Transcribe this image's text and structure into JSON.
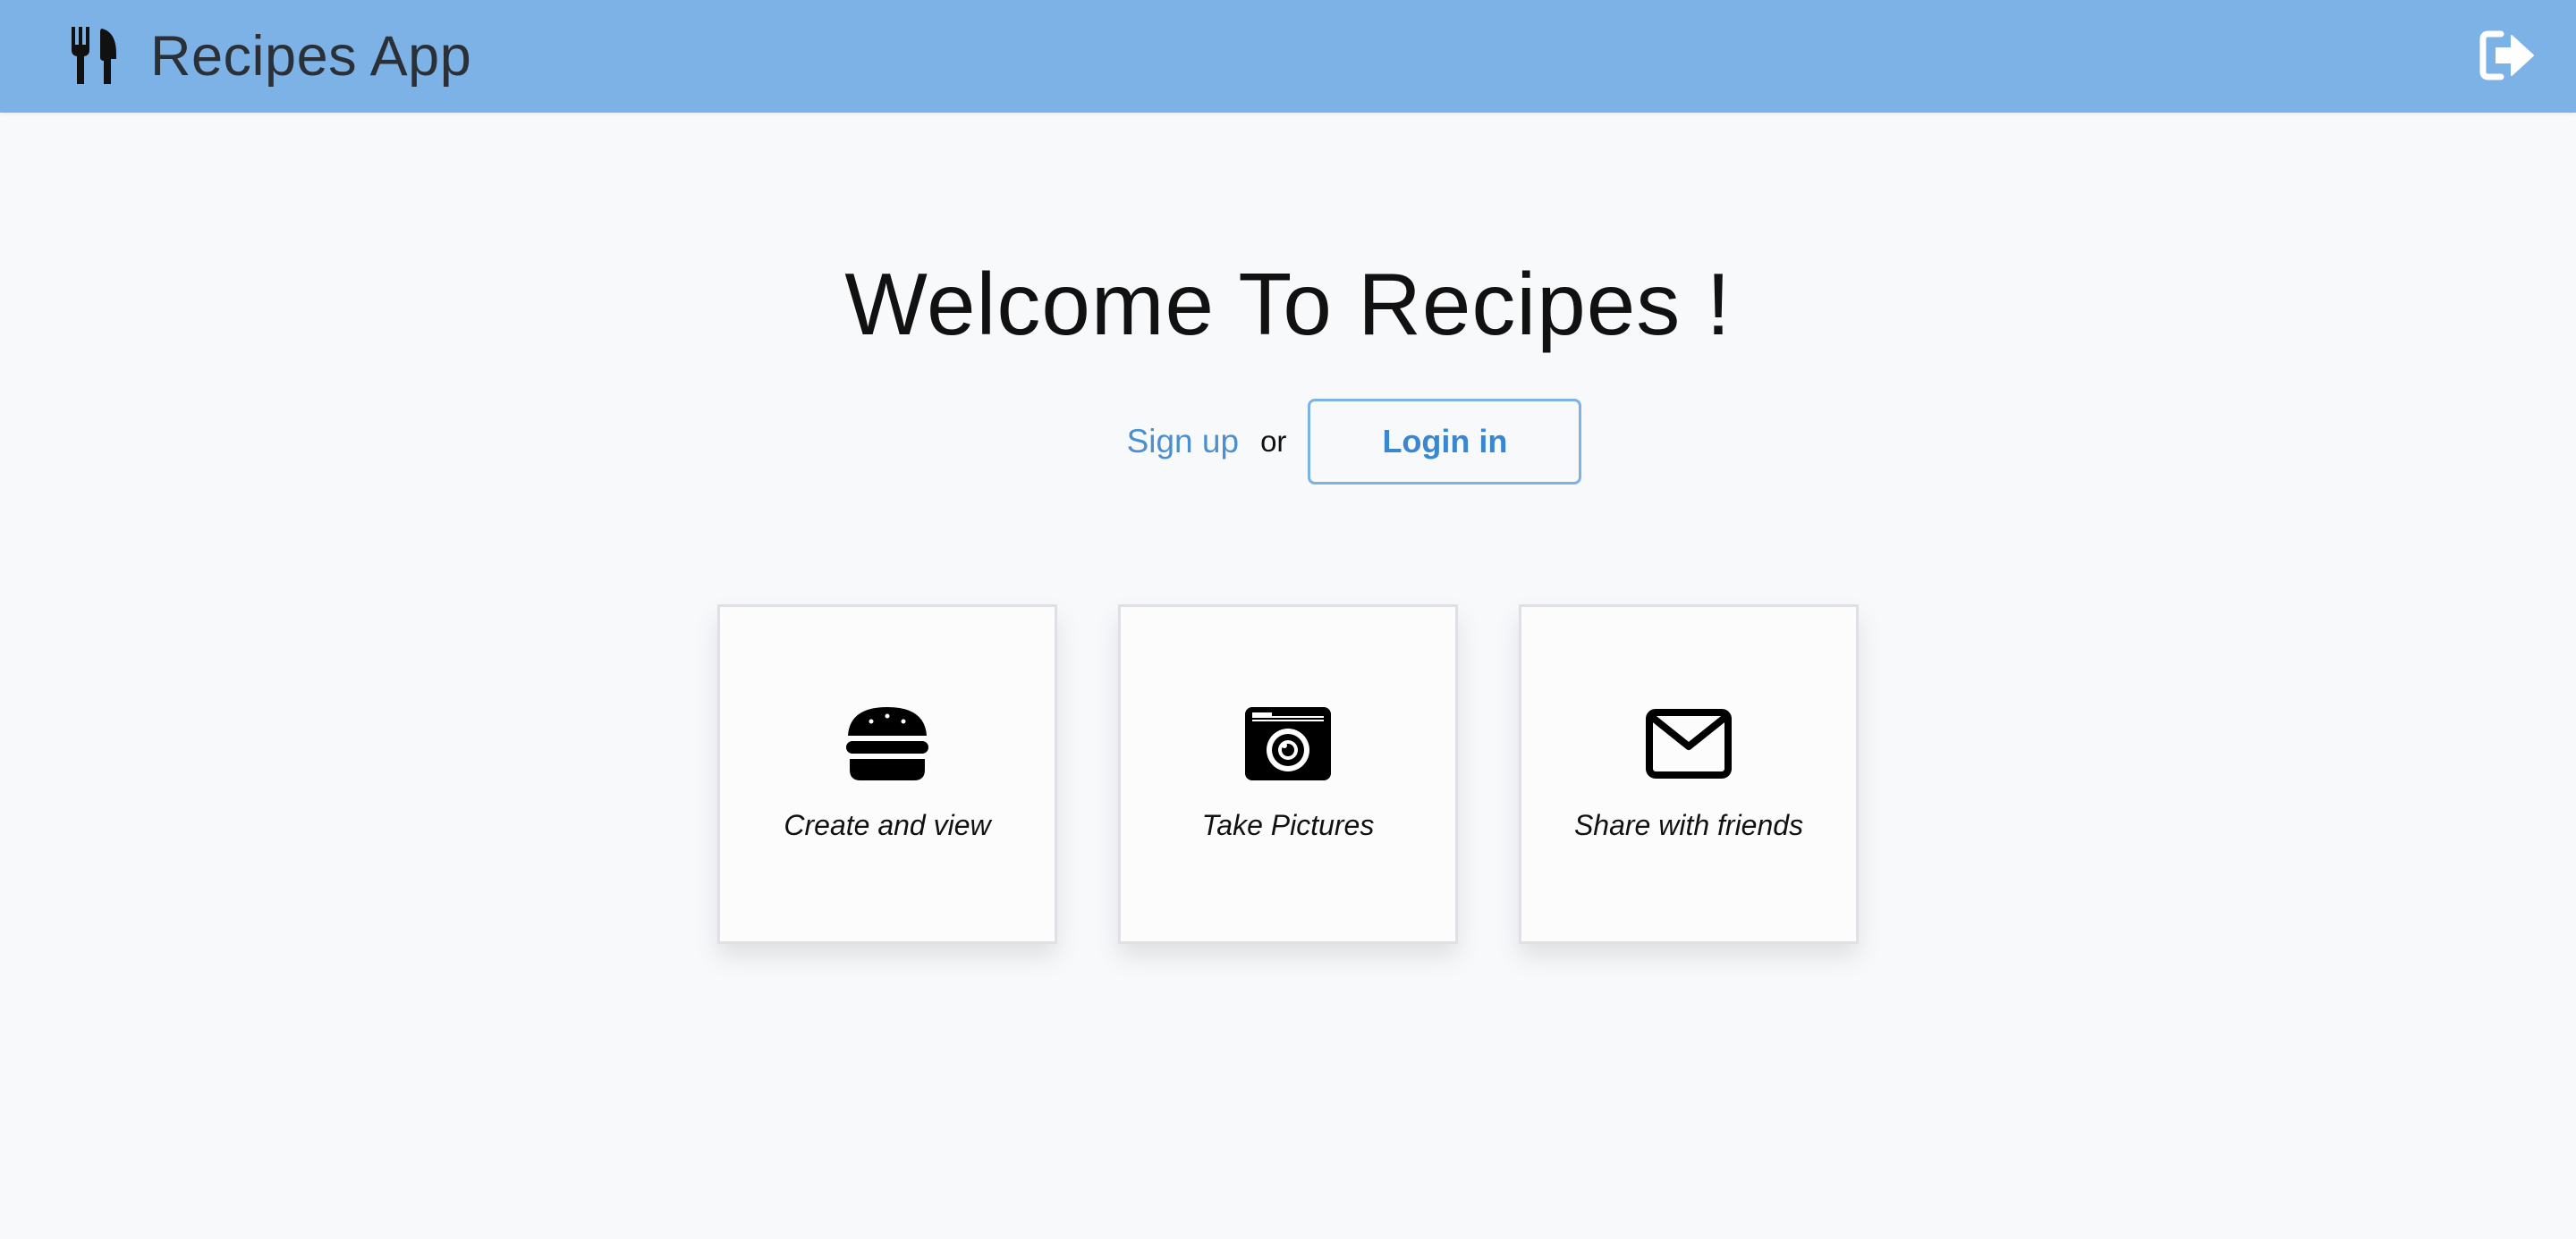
{
  "header": {
    "title": "Recipes App",
    "brand_icon": "utensils-icon",
    "logout_icon": "sign-out-icon",
    "background_color": "#7db2e6"
  },
  "hero": {
    "title": "Welcome To Recipes !",
    "signup_label": "Sign up",
    "or_label": "or",
    "login_label": "Login in",
    "accent_color": "#4a90d0"
  },
  "features": [
    {
      "label": "Create and view",
      "icon": "hamburger-icon"
    },
    {
      "label": "Take Pictures",
      "icon": "camera-icon"
    },
    {
      "label": "Share with friends",
      "icon": "envelope-icon"
    }
  ]
}
